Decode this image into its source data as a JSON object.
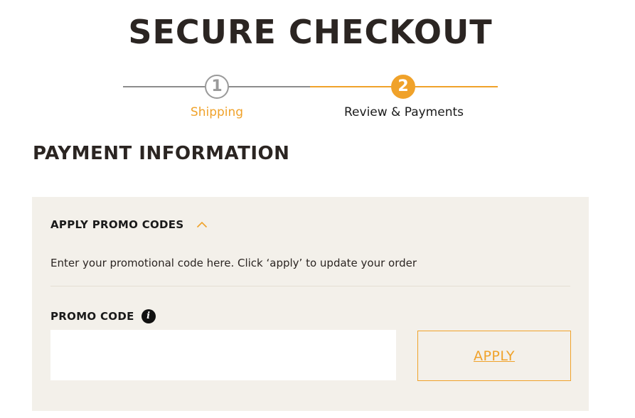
{
  "header": {
    "title": "SECURE CHECKOUT"
  },
  "stepper": {
    "steps": [
      {
        "number": "1",
        "label": "Shipping",
        "state": "completed"
      },
      {
        "number": "2",
        "label": "Review & Payments",
        "state": "active"
      }
    ]
  },
  "payment": {
    "heading": "PAYMENT INFORMATION",
    "promo": {
      "toggle_label": "APPLY PROMO CODES",
      "toggle_icon": "chevron-up-icon",
      "description": "Enter your promotional code here. Click ‘apply’ to update your order",
      "field_label": "PROMO CODE",
      "info_icon": "i",
      "input_value": "",
      "apply_label": "APPLY"
    }
  },
  "colors": {
    "accent": "#f0a22a",
    "panel_bg": "#f3f0ea",
    "text": "#2b2522",
    "inactive_step": "#9a9a9a"
  }
}
